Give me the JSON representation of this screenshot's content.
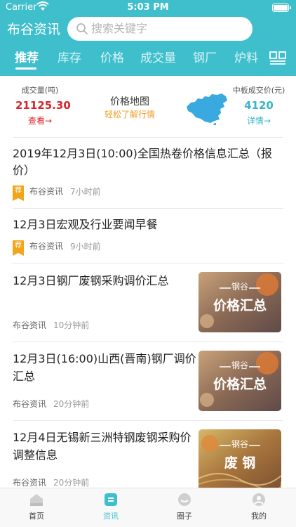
{
  "status_bar": {
    "carrier": "Carrier",
    "time": "5:03 PM"
  },
  "header": {
    "brand": "布谷资讯",
    "search_placeholder": "搜索关键字"
  },
  "tabs": [
    {
      "label": "推荐",
      "active": true
    },
    {
      "label": "库存"
    },
    {
      "label": "价格"
    },
    {
      "label": "成交量"
    },
    {
      "label": "钢厂"
    },
    {
      "label": "炉料"
    }
  ],
  "stats": {
    "volume": {
      "label": "成交量(吨)",
      "value": "21125.30",
      "link": "查看→"
    },
    "map": {
      "title": "价格地图",
      "subtitle": "轻松了解行情"
    },
    "price": {
      "label": "中板成交价(元)",
      "value": "4120",
      "link": "详情→"
    }
  },
  "news": [
    {
      "title_line1": "2019年12月3日(10:00)全国热卷价格信息汇总（报",
      "title_line2": "价）",
      "badge": "荐",
      "source": "布谷资讯",
      "time": "7小时前"
    },
    {
      "title_line1": "12月3日宏观及行业要闻早餐",
      "badge": "荐",
      "source": "布谷资讯",
      "time": "9小时前"
    },
    {
      "title_line1": "12月3日钢厂废钢采购调价汇总",
      "source": "布谷资讯",
      "time": "10分钟前",
      "thumb_top": "钢谷",
      "thumb_text": "价格汇总"
    },
    {
      "title_line1": "12月3日(16:00)山西(晋南)钢厂调价",
      "title_line2": "汇总",
      "source": "布谷资讯",
      "time": "20分钟前",
      "thumb_top": "钢谷",
      "thumb_text": "价格汇总"
    },
    {
      "title_line1": "12月4日无锡新三洲特钢废钢采购价",
      "title_line2": "调整信息",
      "source": "布谷资讯",
      "time": "20分钟前",
      "thumb_top": "钢谷",
      "thumb_text": "废 钢"
    }
  ],
  "tabbar": [
    {
      "label": "首页"
    },
    {
      "label": "资讯",
      "active": true
    },
    {
      "label": "圈子"
    },
    {
      "label": "我的"
    }
  ],
  "colors": {
    "header": "#3fbfcc",
    "accent_red": "#d9232a",
    "accent_teal": "#39b6c4",
    "badge": "#f2a51a"
  }
}
